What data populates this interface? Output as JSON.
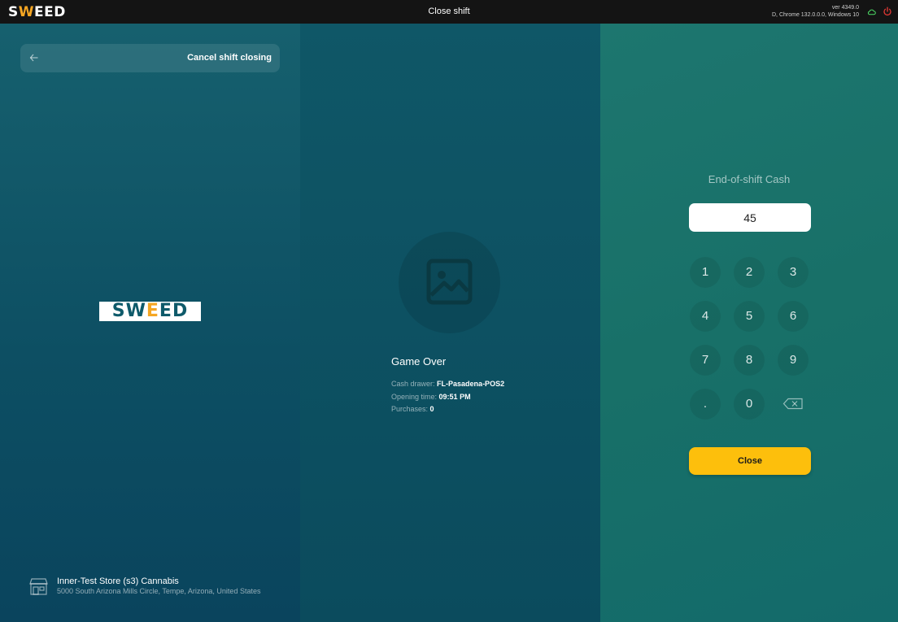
{
  "topbar": {
    "brand": {
      "pre": "S",
      "accent": "W",
      "post": "EED"
    },
    "title": "Close shift",
    "version_line1": "ver 4349.0",
    "version_line2": "D, Chrome 132.0.0.0, Windows 10",
    "icons": {
      "connection": "cloud-icon",
      "logout": "power-icon"
    }
  },
  "left": {
    "cancel_label": "Cancel shift closing",
    "logo": {
      "pre": "SW",
      "accent": "E",
      "post": "ED"
    },
    "store": {
      "name": "Inner-Test Store (s3) Cannabis",
      "address": "5000 South Arizona Mills Circle, Tempe, Arizona, United States"
    }
  },
  "middle": {
    "employee_name": "Game Over",
    "cash_drawer_label": "Cash drawer:",
    "cash_drawer_value": "FL-Pasadena-POS2",
    "opening_time_label": "Opening time:",
    "opening_time_value": "09:51 PM",
    "purchases_label": "Purchases:",
    "purchases_value": "0"
  },
  "right": {
    "title": "End-of-shift Cash",
    "cash_value": "45",
    "keys": [
      "1",
      "2",
      "3",
      "4",
      "5",
      "6",
      "7",
      "8",
      "9",
      ".",
      "0"
    ],
    "close_label": "Close"
  },
  "colors": {
    "accent_yellow": "#fdbf0c",
    "brand_orange": "#f5a623",
    "topbar": "#141414",
    "online_green": "#4cd964",
    "logout_red": "#e53935"
  }
}
